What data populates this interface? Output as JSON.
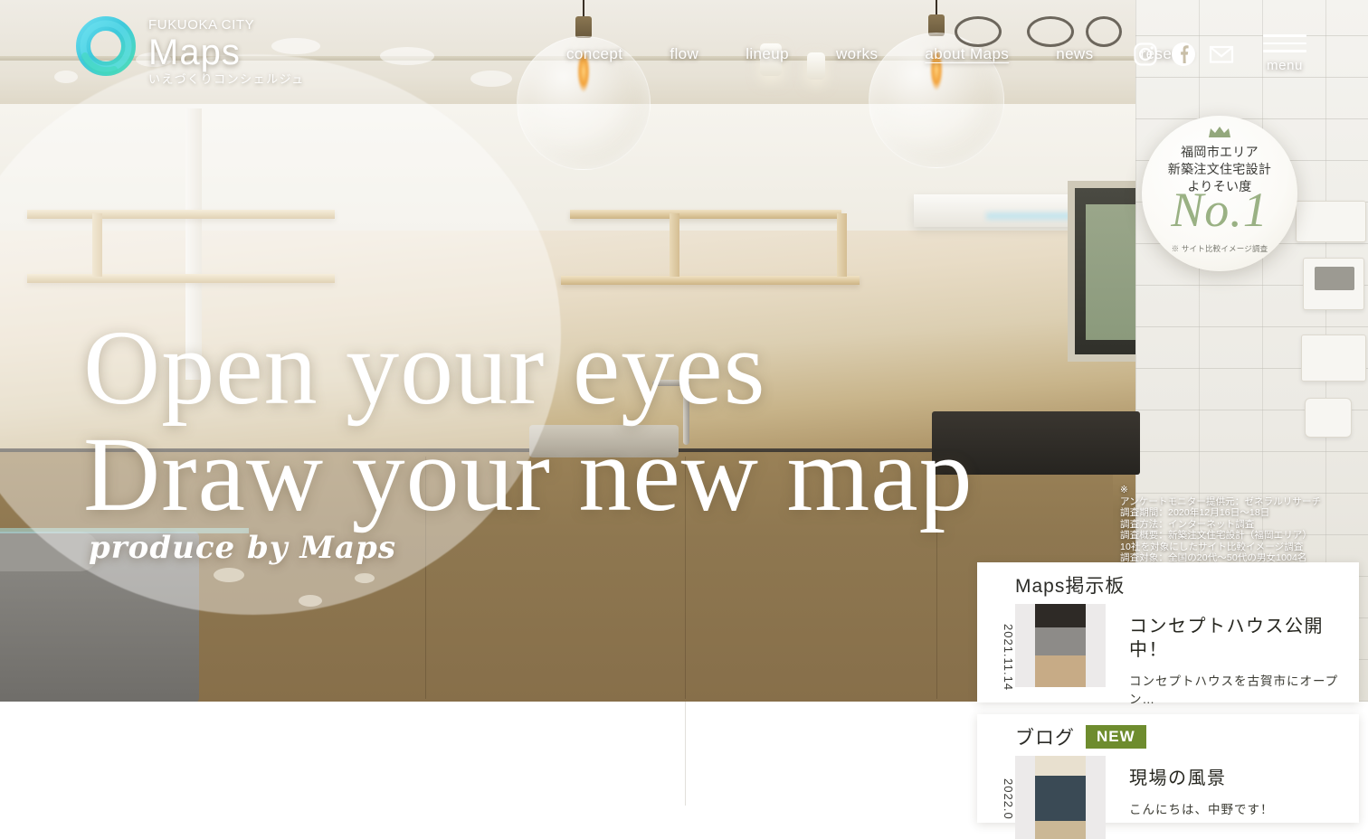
{
  "site": {
    "logo": {
      "top_text": "FUKUOKA CITY",
      "main_text": "Maps",
      "sub_text": "いえづくりコンシェルジュ",
      "ring_icon": "turquoise-ring-icon",
      "ring_color": "#3fc9d6"
    },
    "nav": [
      {
        "label": "concept",
        "active": false
      },
      {
        "label": "flow",
        "active": false
      },
      {
        "label": "lineup",
        "active": false
      },
      {
        "label": "works",
        "active": false
      },
      {
        "label": "about Maps",
        "active": true
      },
      {
        "label": "news",
        "active": false
      },
      {
        "label": "reserve",
        "active": false
      }
    ],
    "social": [
      {
        "icon": "instagram-icon"
      },
      {
        "icon": "facebook-icon"
      },
      {
        "icon": "mail-icon"
      }
    ],
    "menu": {
      "label": "menu",
      "icon": "hamburger-icon"
    }
  },
  "hero": {
    "headline_line1": "Open your eyes",
    "headline_line2": "Draw your new map",
    "tagline": "produce by Maps"
  },
  "badge": {
    "crown_icon": "crown-icon",
    "line1": "福岡市エリア",
    "line2": "新築注文住宅設計",
    "line3": "よりそい度",
    "rank": "No.1",
    "note": "※ サイト比較イメージ調査",
    "accent_color": "#9ab184"
  },
  "survey_note": {
    "mark": "※",
    "lines": [
      "アンケートモニター提供元：ゼネラルリサーチ",
      "調査期間：2020年12月16日〜18日",
      "調査方法：インターネット調査",
      "調査概要：新築注文住宅設計（福岡エリア）",
      "10社を対象にしたサイト比較イメージ調査",
      "調査対象：全国の20代〜50代の男女1004名"
    ]
  },
  "cards": [
    {
      "category": "Maps掲示板",
      "badge": "",
      "date": "2021.11.14",
      "thumb": "room-interior-thumbnail",
      "title": "コンセプトハウス公開中！",
      "excerpt": "コンセプトハウスを古賀市にオープン…"
    },
    {
      "category": "ブログ",
      "badge": "NEW",
      "date": "2022.0",
      "thumb": "person-photo-thumbnail",
      "title": "現場の風景",
      "excerpt": "こんにちは、中野です！"
    }
  ],
  "colors": {
    "new_badge_green": "#6e8c2e",
    "wood_brown": "#8a7450",
    "badge_green": "#9ab184"
  }
}
